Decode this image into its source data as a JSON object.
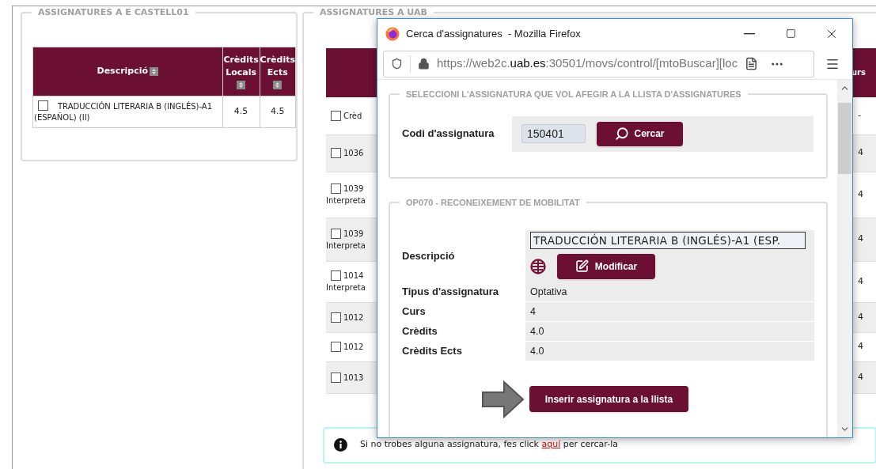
{
  "left_panel": {
    "title": "ASSIGNATURES A E CASTELL01",
    "columns": [
      "Descripció",
      "Crèdits Locals",
      "Crèdits Ects"
    ],
    "rows": [
      {
        "checked": false,
        "description": "TRADUCCIÓN LITERARIA B (INGLÉS)-A1 (ESPAÑOL) (II)",
        "credits_locals": "4.5",
        "credits_ects": "4.5"
      }
    ]
  },
  "right_panel": {
    "title": "ASSIGNATURES A UAB",
    "last_column": "urs",
    "rows": [
      {
        "checked": false,
        "lines": [
          "Crèd"
        ],
        "last": "-"
      },
      {
        "checked": false,
        "lines": [
          "1036"
        ],
        "last": "4"
      },
      {
        "checked": false,
        "lines": [
          "1039",
          "Interpreta"
        ],
        "last": "4"
      },
      {
        "checked": false,
        "lines": [
          "1039",
          "Interpreta"
        ],
        "last": "4"
      },
      {
        "checked": false,
        "lines": [
          "1014",
          "Interpreta"
        ],
        "last": "4"
      },
      {
        "checked": false,
        "lines": [
          "1012"
        ],
        "last": "4"
      },
      {
        "checked": false,
        "lines": [
          "1012"
        ],
        "last": "4"
      },
      {
        "checked": false,
        "lines": [
          "1013"
        ],
        "last": "4"
      }
    ],
    "info": {
      "before": "Si no trobes alguna assignatura, fes click",
      "link": "aquí",
      "after": "per cercar-la"
    }
  },
  "popup": {
    "title": "Cerca d'assignatures  - Mozilla Firefox",
    "url": {
      "prefix": "https://web2c.",
      "domain": "uab.es",
      "suffix": ":30501/movs/control/[mtoBuscar][loc"
    },
    "search_section": {
      "title": "SELECCIONI L'ASSIGNATURA QUE VOL AFEGIR A LA LLISTA D'ASSIGNATURES",
      "label": "Codi d'assignatura",
      "value": "150401",
      "button": "Cercar"
    },
    "detail_section": {
      "title": "OP070 - RECONEIXEMENT DE MOBILITAT",
      "description_label": "Descripció",
      "description_value": "TRADUCCIÓN LITERARIA B (INGLÉS)-A1 (ESP.",
      "modify_button": "Modificar",
      "fields": [
        {
          "label": "Tipus d'assignatura",
          "value": "Optativa"
        },
        {
          "label": "Curs",
          "value": "4"
        },
        {
          "label": "Crèdits",
          "value": "4.0"
        },
        {
          "label": "Crèdits Ects",
          "value": "4.0"
        }
      ],
      "insert_button": "Inserir assignatura a la llista"
    }
  }
}
